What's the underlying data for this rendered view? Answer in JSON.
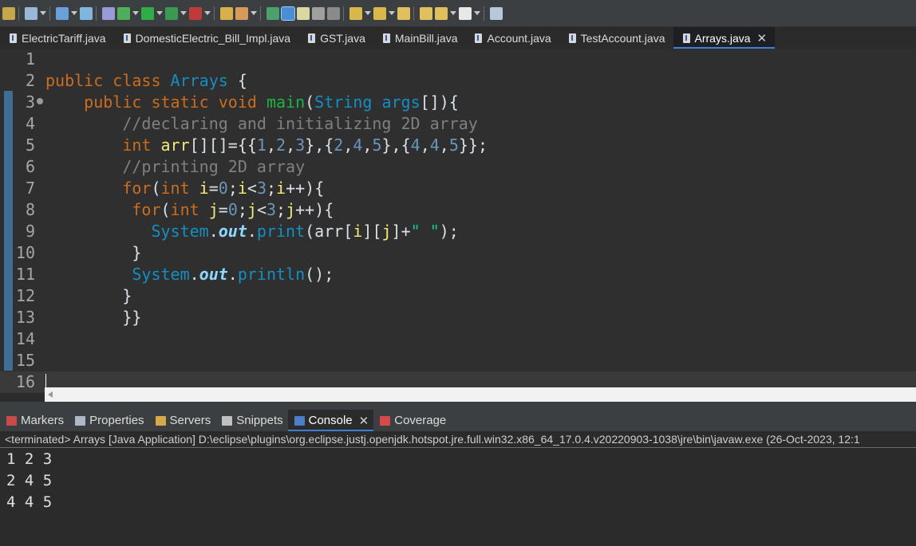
{
  "toolbar": {
    "items": [
      {
        "icon": "debug-icon",
        "color": "#c8a64a"
      },
      {
        "icon": "new-wizard-icon",
        "color": "#9ab6d8"
      },
      {
        "icon": "server-icon",
        "color": "#6aa0d8"
      },
      {
        "icon": "web-browser-icon",
        "color": "#7fb6e0"
      },
      {
        "icon": "new-server-icon",
        "color": "#9a9ad8"
      },
      {
        "icon": "debug-bug-icon",
        "color": "#4fae5a"
      },
      {
        "icon": "run-icon",
        "color": "#2fae46"
      },
      {
        "icon": "run-as-icon",
        "color": "#3a9a52"
      },
      {
        "icon": "coverage-icon",
        "color": "#c03a3a"
      },
      {
        "icon": "open-project-icon",
        "color": "#d8b04a"
      },
      {
        "icon": "pen-icon",
        "color": "#d89a5a"
      },
      {
        "icon": "highlight-occurrences-icon",
        "color": "#4ca06a"
      },
      {
        "icon": "toggle-breadcrumb-icon",
        "color": "#4a8fd6"
      },
      {
        "icon": "edit-icon",
        "color": "#d8d8a0"
      },
      {
        "icon": "block-selection-icon",
        "color": "#a0a0a0"
      },
      {
        "icon": "show-whitespace-icon",
        "color": "#8a8a8a"
      },
      {
        "icon": "next-annotation-icon",
        "color": "#d8b84a"
      },
      {
        "icon": "previous-annotation-icon",
        "color": "#d8b84a"
      },
      {
        "icon": "last-edit-location-icon",
        "color": "#e0c05a"
      },
      {
        "icon": "next-edit-location-icon",
        "color": "#e0c05a"
      },
      {
        "icon": "back-arrow-icon",
        "color": "#e0c05a"
      },
      {
        "icon": "forward-arrow-icon",
        "color": "#e8e8e8"
      },
      {
        "icon": "pin-editor-icon",
        "color": "#b8c8d8"
      }
    ]
  },
  "tabs": [
    {
      "label": "ElectricTariff.java",
      "active": false
    },
    {
      "label": "DomesticElectric_Bill_Impl.java",
      "active": false
    },
    {
      "label": "GST.java",
      "active": false
    },
    {
      "label": "MainBill.java",
      "active": false
    },
    {
      "label": "Account.java",
      "active": false
    },
    {
      "label": "TestAccount.java",
      "active": false
    },
    {
      "label": "Arrays.java",
      "active": true
    }
  ],
  "close_glyph": "✕",
  "editor": {
    "line_numbers": [
      "1",
      "2",
      "3",
      "4",
      "5",
      "6",
      "7",
      "8",
      "9",
      "10",
      "11",
      "12",
      "13",
      "14",
      "15",
      "16"
    ],
    "lines": [
      [],
      [
        [
          "kw",
          "public class "
        ],
        [
          "cls",
          "Arrays"
        ],
        [
          "p",
          " {"
        ]
      ],
      [
        [
          "p",
          "    "
        ],
        [
          "kw",
          "public static void "
        ],
        [
          "mth",
          "main"
        ],
        [
          "p",
          "("
        ],
        [
          "cls",
          "String"
        ],
        [
          "p",
          " "
        ],
        [
          "cls",
          "args"
        ],
        [
          "p",
          "[]){"
        ]
      ],
      [
        [
          "p",
          "        "
        ],
        [
          "cmt",
          "//declaring and initializing 2D array"
        ]
      ],
      [
        [
          "p",
          "        "
        ],
        [
          "kw",
          "int "
        ],
        [
          "var",
          "arr"
        ],
        [
          "p",
          "[][]={{"
        ],
        [
          "num",
          "1"
        ],
        [
          "p",
          ","
        ],
        [
          "num",
          "2"
        ],
        [
          "p",
          ","
        ],
        [
          "num",
          "3"
        ],
        [
          "p",
          "},{"
        ],
        [
          "num",
          "2"
        ],
        [
          "p",
          ","
        ],
        [
          "num",
          "4"
        ],
        [
          "p",
          ","
        ],
        [
          "num",
          "5"
        ],
        [
          "p",
          "},{"
        ],
        [
          "num",
          "4"
        ],
        [
          "p",
          ","
        ],
        [
          "num",
          "4"
        ],
        [
          "p",
          ","
        ],
        [
          "num",
          "5"
        ],
        [
          "p",
          "}};"
        ]
      ],
      [
        [
          "p",
          "        "
        ],
        [
          "cmt",
          "//printing 2D array"
        ]
      ],
      [
        [
          "p",
          "        "
        ],
        [
          "kw",
          "for"
        ],
        [
          "p",
          "("
        ],
        [
          "kw",
          "int "
        ],
        [
          "var",
          "i"
        ],
        [
          "p",
          "="
        ],
        [
          "num",
          "0"
        ],
        [
          "p",
          ";"
        ],
        [
          "var",
          "i"
        ],
        [
          "p",
          "<"
        ],
        [
          "num",
          "3"
        ],
        [
          "p",
          ";"
        ],
        [
          "var",
          "i"
        ],
        [
          "p",
          "++){"
        ]
      ],
      [
        [
          "p",
          "         "
        ],
        [
          "kw",
          "for"
        ],
        [
          "p",
          "("
        ],
        [
          "kw",
          "int "
        ],
        [
          "var",
          "j"
        ],
        [
          "p",
          "="
        ],
        [
          "num",
          "0"
        ],
        [
          "p",
          ";"
        ],
        [
          "var",
          "j"
        ],
        [
          "p",
          "<"
        ],
        [
          "num",
          "3"
        ],
        [
          "p",
          ";"
        ],
        [
          "var",
          "j"
        ],
        [
          "p",
          "++){"
        ]
      ],
      [
        [
          "p",
          "           "
        ],
        [
          "cls",
          "System"
        ],
        [
          "p",
          "."
        ],
        [
          "fld",
          "out"
        ],
        [
          "p",
          "."
        ],
        [
          "cls",
          "print"
        ],
        [
          "p",
          "(arr["
        ],
        [
          "var",
          "i"
        ],
        [
          "p",
          "]["
        ],
        [
          "var",
          "j"
        ],
        [
          "p",
          "]+"
        ],
        [
          "str",
          "\" \""
        ],
        [
          "p",
          ");"
        ]
      ],
      [
        [
          "p",
          "         }"
        ]
      ],
      [
        [
          "p",
          "         "
        ],
        [
          "cls",
          "System"
        ],
        [
          "p",
          "."
        ],
        [
          "fld",
          "out"
        ],
        [
          "p",
          "."
        ],
        [
          "cls",
          "println"
        ],
        [
          "p",
          "();"
        ]
      ],
      [
        [
          "p",
          "        }"
        ]
      ],
      [
        [
          "p",
          "        }}"
        ]
      ],
      [],
      [],
      []
    ]
  },
  "views": {
    "tabs": [
      {
        "label": "Markers",
        "icon": "markers-icon",
        "color": "#c84a4a",
        "active": false
      },
      {
        "label": "Properties",
        "icon": "properties-icon",
        "color": "#b0b8c8",
        "active": false
      },
      {
        "label": "Servers",
        "icon": "servers-icon",
        "color": "#d8a84a",
        "active": false
      },
      {
        "label": "Snippets",
        "icon": "snippets-icon",
        "color": "#c0c0c0",
        "active": false
      },
      {
        "label": "Console",
        "icon": "console-icon",
        "color": "#4a7fc8",
        "active": true
      },
      {
        "label": "Coverage",
        "icon": "coverage-icon",
        "color": "#d84a4a",
        "active": false
      }
    ]
  },
  "console": {
    "terminated": "<terminated> Arrays [Java Application] D:\\eclipse\\plugins\\org.eclipse.justj.openjdk.hotspot.jre.full.win32.x86_64_17.0.4.v20220903-1038\\jre\\bin\\javaw.exe  (26-Oct-2023, 12:1",
    "output": [
      "1 2 3",
      "2 4 5",
      "4 4 5"
    ]
  }
}
